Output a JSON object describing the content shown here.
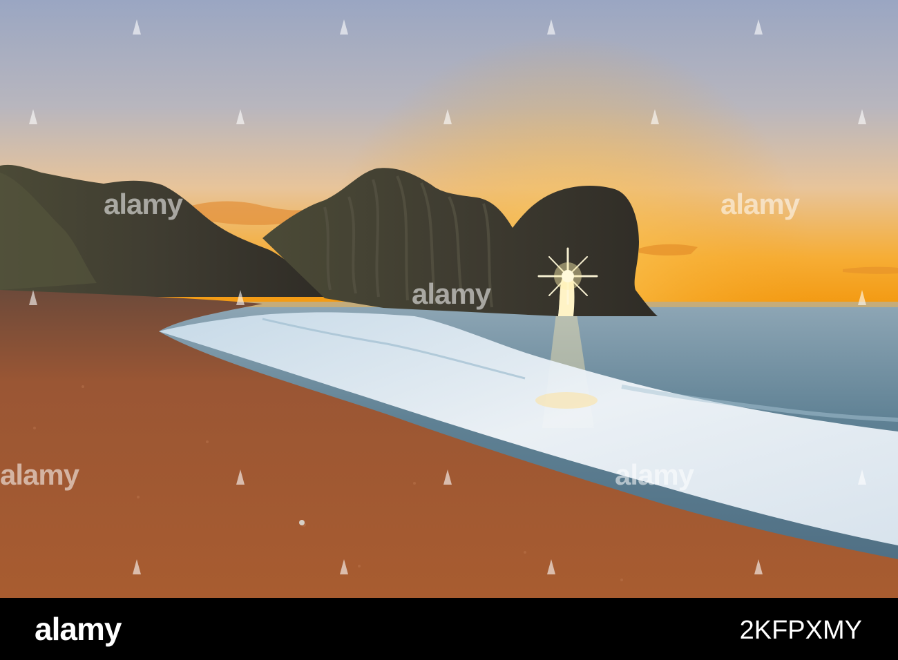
{
  "photo": {
    "subject": "Sea arch at sunrise, sun star through the arch, sandy shingle beach with surf",
    "colors": {
      "sky_top": "#a3adc4",
      "sky_horizon": "#f6a21c",
      "sun": "#fff6c8",
      "cliff": "#3e3a2e",
      "sea": "#6e8fa3",
      "foam": "#eef3f8",
      "sand": "#a2562e"
    }
  },
  "watermark": {
    "brand": "alamy"
  },
  "footer": {
    "logo": "alamy",
    "image_id": "2KFPXMY"
  }
}
